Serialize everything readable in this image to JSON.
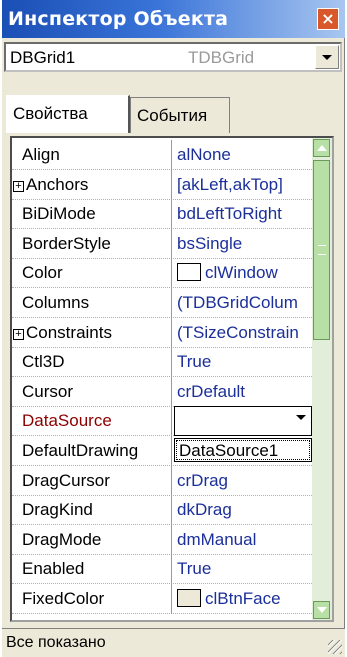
{
  "window": {
    "title": "Инспектор Объекта",
    "close_icon": "close-icon"
  },
  "object_selector": {
    "name": "DBGrid1",
    "type": "TDBGrid"
  },
  "tabs": [
    {
      "label": "Свойства",
      "active": true
    },
    {
      "label": "События",
      "active": false
    }
  ],
  "properties": [
    {
      "name": "Align",
      "value": "alNone"
    },
    {
      "name": "Anchors",
      "value": "[akLeft,akTop]",
      "expandable": true
    },
    {
      "name": "BiDiMode",
      "value": "bdLeftToRight"
    },
    {
      "name": "BorderStyle",
      "value": "bsSingle"
    },
    {
      "name": "Color",
      "value": "clWindow",
      "color_swatch": "#ffffff"
    },
    {
      "name": "Columns",
      "value": "(TDBGridColum"
    },
    {
      "name": "Constraints",
      "value": "(TSizeConstrain",
      "expandable": true
    },
    {
      "name": "Ctl3D",
      "value": "True"
    },
    {
      "name": "Cursor",
      "value": "crDefault"
    },
    {
      "name": "DataSource",
      "value": "",
      "selected": true,
      "has_dropdown": true
    },
    {
      "name": "DefaultDrawing",
      "value": ""
    },
    {
      "name": "DragCursor",
      "value": "crDrag"
    },
    {
      "name": "DragKind",
      "value": "dkDrag"
    },
    {
      "name": "DragMode",
      "value": "dmManual"
    },
    {
      "name": "Enabled",
      "value": "True"
    },
    {
      "name": "FixedColor",
      "value": "clBtnFace",
      "color_swatch": "#ece9d8"
    }
  ],
  "dropdown_popup": {
    "items": [
      "DataSource1"
    ]
  },
  "status_bar": {
    "text": "Все показано"
  },
  "colors": {
    "title_start": "#1a4fb5",
    "value_text": "#1b2f9a",
    "selected_name": "#8b0000",
    "scrollbar": "#b8e0a6"
  }
}
